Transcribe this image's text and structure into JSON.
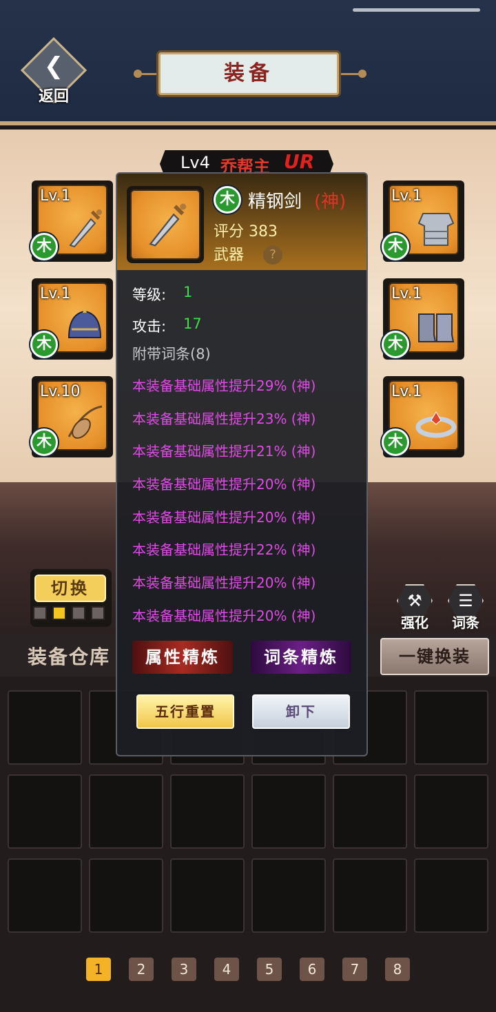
{
  "header": {
    "back_label": "返回",
    "title": "装备"
  },
  "hero": {
    "level": "Lv4",
    "name": "乔帮主",
    "rank": "UR"
  },
  "slots": [
    {
      "level": "Lv.1",
      "element": "木",
      "icon": "sword-icon"
    },
    {
      "level": "Lv.1",
      "element": "木",
      "icon": "helmet-icon"
    },
    {
      "level": "Lv.10",
      "element": "木",
      "icon": "amulet-icon"
    },
    {
      "level": "Lv.1",
      "element": "木",
      "icon": "armor-icon"
    },
    {
      "level": "Lv.1",
      "element": "木",
      "icon": "boots-icon"
    },
    {
      "level": "Lv.1",
      "element": "木",
      "icon": "ring-icon"
    }
  ],
  "switch": {
    "label": "切换",
    "active_index": 1,
    "count": 4
  },
  "tools": {
    "enhance": "强化",
    "affix": "词条"
  },
  "warehouse": {
    "title": "装备仓库",
    "one_key": "一键换装"
  },
  "pages": [
    "1",
    "2",
    "3",
    "4",
    "5",
    "6",
    "7",
    "8"
  ],
  "popup": {
    "element": "木",
    "name": "精钢剑",
    "rank": "(神)",
    "score": "评分 383",
    "type": "武器",
    "help": "?",
    "level_label": "等级:",
    "level_value": "1",
    "attack_label": "攻击:",
    "attack_value": "17",
    "affix_header": "附带词条(8)",
    "affixes": [
      "本装备基础属性提升29% (神)",
      "本装备基础属性提升23% (神)",
      "本装备基础属性提升21% (神)",
      "本装备基础属性提升20% (神)",
      "本装备基础属性提升20% (神)",
      "本装备基础属性提升22% (神)",
      "本装备基础属性提升20% (神)",
      "本装备基础属性提升20% (神)"
    ],
    "attr_refine": "属性精炼",
    "affix_refine": "词条精炼",
    "reset": "五行重置",
    "unequip": "卸下"
  },
  "colors": {
    "rank_red": "#e23226",
    "affix_purple": "#e04ae6",
    "stat_green": "#3ae046",
    "wood_green": "#2a9a2e"
  }
}
